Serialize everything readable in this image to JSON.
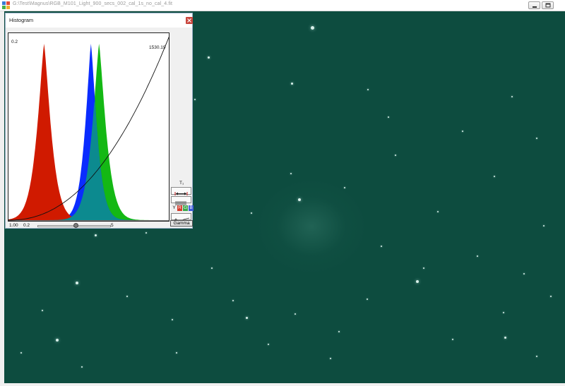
{
  "window": {
    "title": "G:\\Test\\Magnus\\RGB_M101_Light_900_secs_002_cal_1s_no_cal_4.fit",
    "controls": [
      "minimize-icon",
      "restore-icon"
    ]
  },
  "histogram_window": {
    "title": "Histogram",
    "close_icon": "close-icon",
    "plot_label_left": "0.2",
    "plot_label_right": "1530.19",
    "gamma_value": "1.00",
    "slider_min": "0.2",
    "slider_max": "5",
    "slider_value_fraction": 0.52,
    "side_controls": {
      "top_label": "T₁",
      "channels": [
        "Y",
        "R",
        "G",
        "B"
      ],
      "gamma_button": "Gamma"
    },
    "colors": {
      "red": "#d01a00",
      "blue": "#0a2cff",
      "green": "#14b814",
      "overlap": "#0c8a8f",
      "window_bg": "#0d4c3f"
    }
  },
  "chart_data": {
    "type": "area",
    "title": "",
    "xlabel": "",
    "ylabel": "",
    "series": [
      {
        "name": "",
        "peak_x": 0.22,
        "width": 0.035,
        "color": "red"
      },
      {
        "name": "",
        "peak_x": 0.51,
        "width": 0.03,
        "color": "blue"
      },
      {
        "name": "",
        "peak_x": 0.56,
        "width": 0.035,
        "color": "green"
      }
    ],
    "curve": {
      "kind": "gamma",
      "gamma": 2.2
    }
  }
}
